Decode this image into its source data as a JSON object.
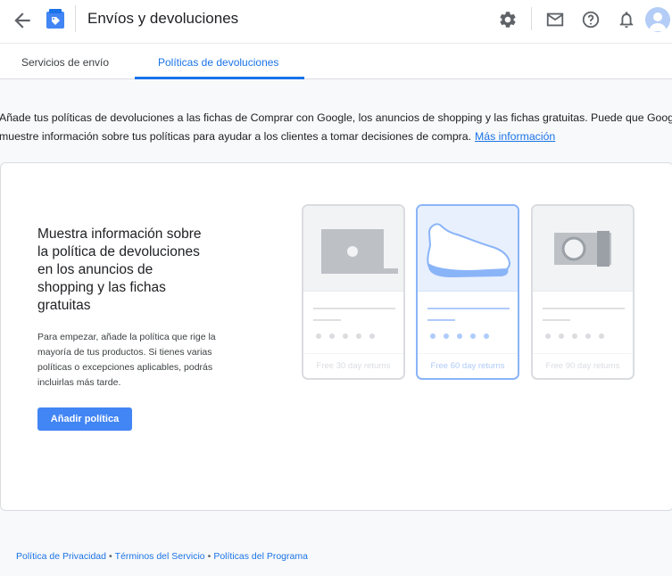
{
  "app": {
    "title": "Envíos y devoluciones"
  },
  "header": {
    "icons": [
      "arrow-back-icon",
      "merchant-logo-icon",
      "gear-icon",
      "mail-icon",
      "help-icon",
      "bell-icon",
      "avatar"
    ]
  },
  "tabs": [
    {
      "label": "Servicios de envío",
      "active": false
    },
    {
      "label": "Políticas de devoluciones",
      "active": true
    }
  ],
  "intro": {
    "line1": "Añade tus políticas de devoluciones a las fichas de Comprar con Google, los anuncios de shopping y las fichas gratuitas. Puede que Google",
    "line2": "muestre información sobre tus políticas para ayudar a los clientes a tomar decisiones de compra.",
    "link": "Más información"
  },
  "card": {
    "heading": "Muestra información sobre la política de devoluciones en los anuncios de shopping y las fichas gratuitas",
    "description": "Para empezar, añade la política que rige la mayoría de tus productos. Si tienes varias políticas o excepciones aplicables, podrás incluirlas más tarde.",
    "button": "Añadir política",
    "products": [
      {
        "icon": "laptop-icon",
        "label": "Free 30 day returns",
        "selected": false
      },
      {
        "icon": "shoe-icon",
        "label": "Free 60 day returns",
        "selected": true
      },
      {
        "icon": "camera-icon",
        "label": "Free 90 day returns",
        "selected": false
      }
    ]
  },
  "footer": {
    "links": [
      "Política de Privacidad",
      "Términos del Servicio",
      "Políticas del Programa"
    ],
    "separator": "•"
  },
  "colors": {
    "accent": "#1a73e8",
    "button": "#4285f4"
  }
}
